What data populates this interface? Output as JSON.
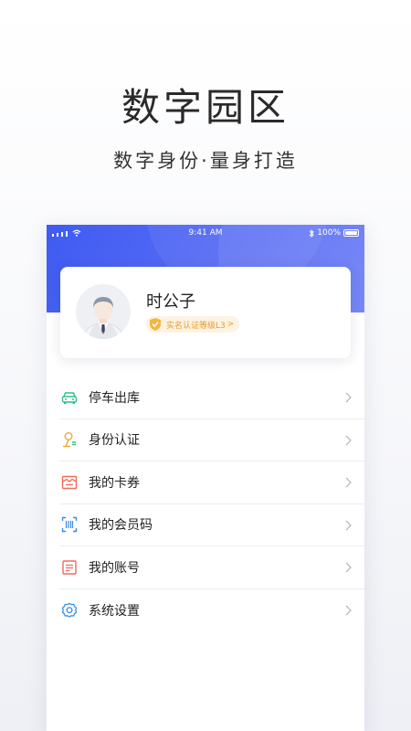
{
  "hero": {
    "title": "数字园区",
    "subtitle": "数字身份·量身打造"
  },
  "statusbar": {
    "time": "9:41 AM",
    "battery": "100%"
  },
  "profile": {
    "name": "时公子",
    "badge": "实名认证等级L3",
    "badge_chevron": ">"
  },
  "menu": {
    "items": [
      {
        "label": "停车出库",
        "icon": "car-icon",
        "color": "#2ec28a"
      },
      {
        "label": "身份认证",
        "icon": "identity-icon",
        "color": "#f2a533"
      },
      {
        "label": "我的卡券",
        "icon": "coupon-icon",
        "color": "#f26a5a"
      },
      {
        "label": "我的会员码",
        "icon": "member-code-icon",
        "color": "#3b8be8"
      },
      {
        "label": "我的账号",
        "icon": "account-icon",
        "color": "#f26a5a"
      },
      {
        "label": "系统设置",
        "icon": "gear-icon",
        "color": "#3b8be8"
      }
    ]
  },
  "colors": {
    "header_blue": "#4a63f3",
    "badge_orange": "#e89a2c"
  }
}
